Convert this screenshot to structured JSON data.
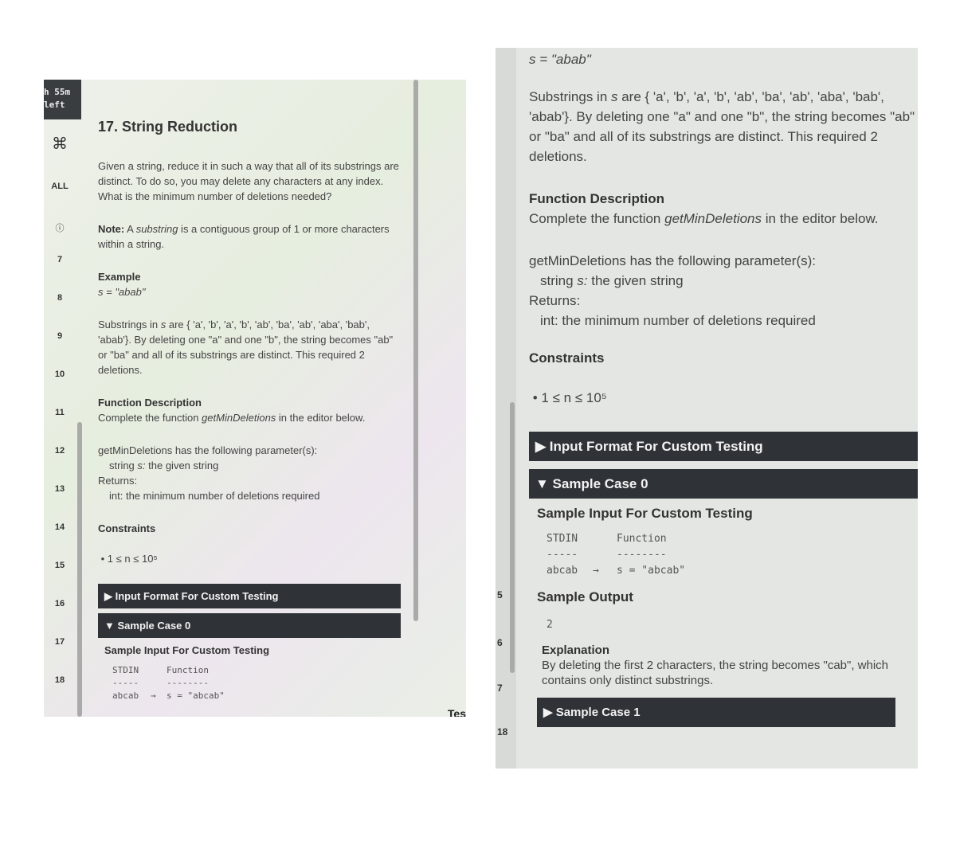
{
  "timer": {
    "line1": "h 55m",
    "line2": "left"
  },
  "sidebar": {
    "cmd_icon": "⌘",
    "all_label": "ALL",
    "info_icon": "info-icon",
    "line_numbers": [
      "7",
      "8",
      "9",
      "10",
      "11",
      "12",
      "13",
      "14",
      "15",
      "16",
      "17",
      "18"
    ]
  },
  "problem": {
    "title": "17. String Reduction",
    "description": "Given a string, reduce it in such a way that all of its substrings are distinct. To do so, you may delete any characters at any index. What is the minimum number of deletions needed?",
    "note_label": "Note:",
    "note_pre": " A ",
    "note_em": "substring",
    "note_post": " is a contiguous group of 1 or more characters within a string.",
    "example_label": "Example",
    "example_value": "s = \"abab\"",
    "example_explain_pre": "Substrings in ",
    "example_explain_em": "s",
    "example_explain_post": " are { 'a', 'b', 'a', 'b', 'ab', 'ba', 'ab', 'aba', 'bab', 'abab'}. By deleting one \"a\" and one \"b\", the string becomes \"ab\" or \"ba\" and all of its substrings are distinct. This required 2 deletions.",
    "func_desc_label": "Function Description",
    "func_desc_pre": "Complete the function ",
    "func_desc_em": "getMinDeletions",
    "func_desc_post": " in the editor below.",
    "params_intro": "getMinDeletions has the following parameter(s):",
    "param_pre": "string ",
    "param_em": "s:",
    "param_post": " the given string",
    "returns_label": "Returns:",
    "returns_value": "int: the minimum number of deletions required",
    "constraints_label": "Constraints",
    "constraint": "1 ≤ n ≤ 10⁵",
    "input_format_bar": "▶ Input Format For Custom Testing",
    "sample0_bar": "▼ Sample Case 0",
    "sample_input_label": "Sample Input For Custom Testing",
    "stdin_h": "STDIN",
    "func_h": "Function",
    "stdin_dash": "-----",
    "func_dash": "--------",
    "stdin_v": "abcab",
    "arrow": "→",
    "func_v": "s = \"abcab\"",
    "sample_output_label": "Sample Output",
    "sample_output_value": "2",
    "explanation_label": "Explanation",
    "explanation_text": "By deleting the first 2 characters, the string becomes \"cab\", which contains only distinct substrings.",
    "sample1_bar": "▶ Sample Case 1"
  },
  "edge": {
    "tes": "Tes",
    "right_gutter": [
      "5",
      "6",
      "7",
      "18"
    ]
  }
}
